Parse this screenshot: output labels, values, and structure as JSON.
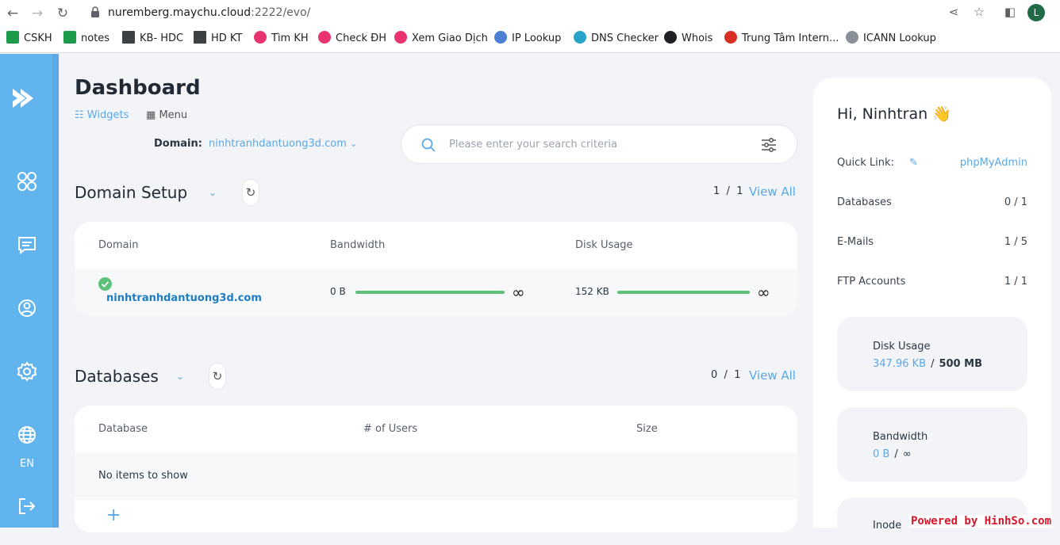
{
  "browser": {
    "url_host": "nuremberg.maychu.cloud",
    "url_rest": ":2222/evo/",
    "profile_initial": "L",
    "bookmarks": [
      "CSKH",
      "notes",
      "KB- HDC",
      "HD KT",
      "Tìm KH",
      "Check ĐH",
      "Xem Giao Dịch",
      "IP Lookup",
      "DNS Checker",
      "Whois",
      "Trung Tâm Intern...",
      "ICANN Lookup"
    ]
  },
  "sidebar": {
    "language": "EN"
  },
  "header": {
    "title": "Dashboard",
    "view_widgets": "Widgets",
    "view_menu": "Menu",
    "domain_label": "Domain:",
    "domain_value": "ninhtranhdantuong3d.com"
  },
  "search": {
    "placeholder": "Please enter your search criteria"
  },
  "domain_setup": {
    "title": "Domain Setup",
    "page_current": "1",
    "page_sep": "/",
    "page_total": "1",
    "view_all": "View All",
    "columns": [
      "Domain",
      "Bandwidth",
      "Disk Usage"
    ],
    "row": {
      "domain": "ninhtranhdantuong3d.com",
      "bandwidth": "0 B",
      "bandwidth_limit": "∞",
      "bandwidth_fill": 1.0,
      "disk": "152 KB",
      "disk_limit": "∞",
      "disk_fill": 1.0
    }
  },
  "databases": {
    "title": "Databases",
    "page_current": "0",
    "page_sep": "/",
    "page_total": "1",
    "view_all": "View All",
    "columns": [
      "Database",
      "# of Users",
      "Size"
    ],
    "empty": "No items to show",
    "add": "+"
  },
  "panel": {
    "greeting": "Hi, Ninhtran 👋",
    "quick_link_label": "Quick Link:",
    "quick_link_value": "phpMyAdmin",
    "stats": [
      {
        "label": "Databases",
        "value": "0 / 1"
      },
      {
        "label": "E-Mails",
        "value": "1 / 5"
      },
      {
        "label": "FTP Accounts",
        "value": "1 / 1"
      }
    ],
    "disk": {
      "title": "Disk Usage",
      "used": "347.96 KB",
      "sep": "/",
      "total": "500 MB"
    },
    "bandwidth": {
      "title": "Bandwidth",
      "used": "0 B",
      "sep": "/",
      "total": "∞"
    },
    "inodes_title": "Inode"
  },
  "watermark": "Powered by HinhSo.com",
  "colors": {
    "accent": "#5aa9e6",
    "sidebar": "#61b4ee",
    "progress": "#5ec17a"
  }
}
